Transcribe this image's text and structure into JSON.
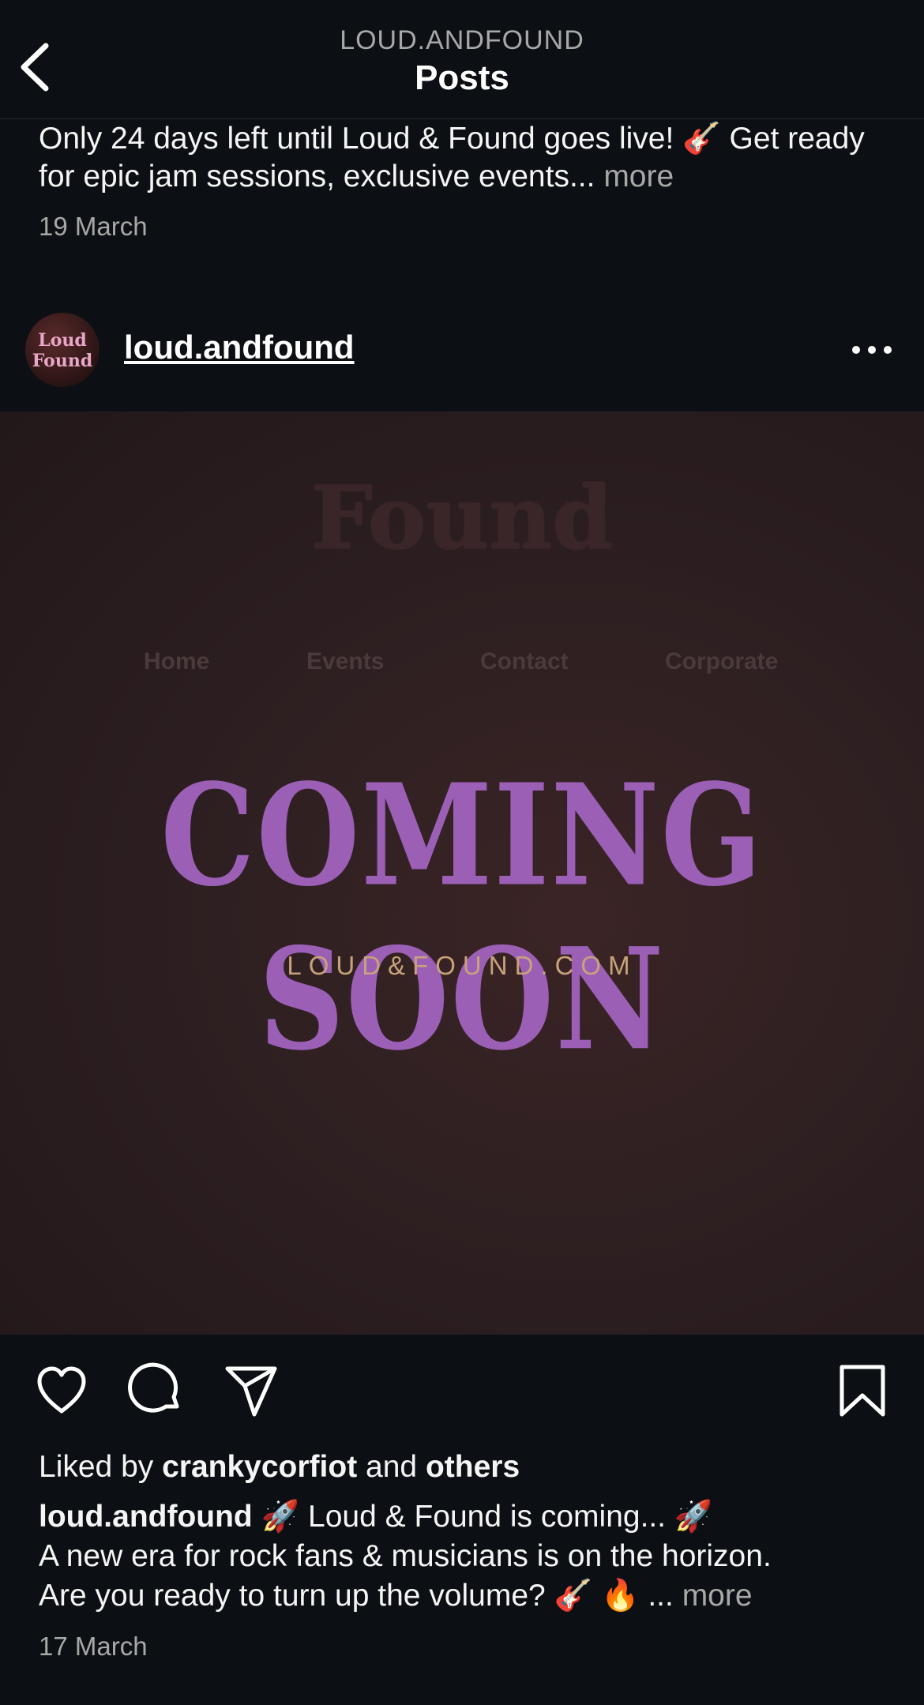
{
  "header": {
    "subtitle": "LOUD.ANDFOUND",
    "title": "Posts",
    "back_icon": "chevron-left-icon"
  },
  "previous_post": {
    "caption": "Only 24 days left until Loud & Found goes live! 🎸 Get ready for epic jam sessions, exclusive events...",
    "more_label": "more",
    "date": "19 March"
  },
  "post": {
    "username": "loud.andfound",
    "avatar_text_line1": "Loud",
    "avatar_text_line2": "Found",
    "menu_icon": "more-horizontal-icon",
    "image": {
      "logo_text": "Found",
      "nav_items": [
        "Home",
        "Events",
        "Contact",
        "Corporate"
      ],
      "headline": "COMING SOON",
      "url_text": "LOUD&FOUND.COM",
      "headline_color": "#9b5fb6"
    },
    "actions": {
      "like_icon": "heart-icon",
      "comment_icon": "comment-icon",
      "share_icon": "send-icon",
      "save_icon": "bookmark-icon"
    },
    "likes": {
      "prefix": "Liked by",
      "user": "crankycorfiot",
      "connector": "and",
      "others": "others"
    },
    "caption": {
      "username": "loud.andfound",
      "line1": "🚀 Loud & Found is coming... 🚀",
      "line2": "A new era for rock fans & musicians is on the horizon.",
      "line3": "Are you ready to turn up the volume? 🎸 🔥 ...",
      "more_label": "more"
    },
    "date": "17 March"
  }
}
